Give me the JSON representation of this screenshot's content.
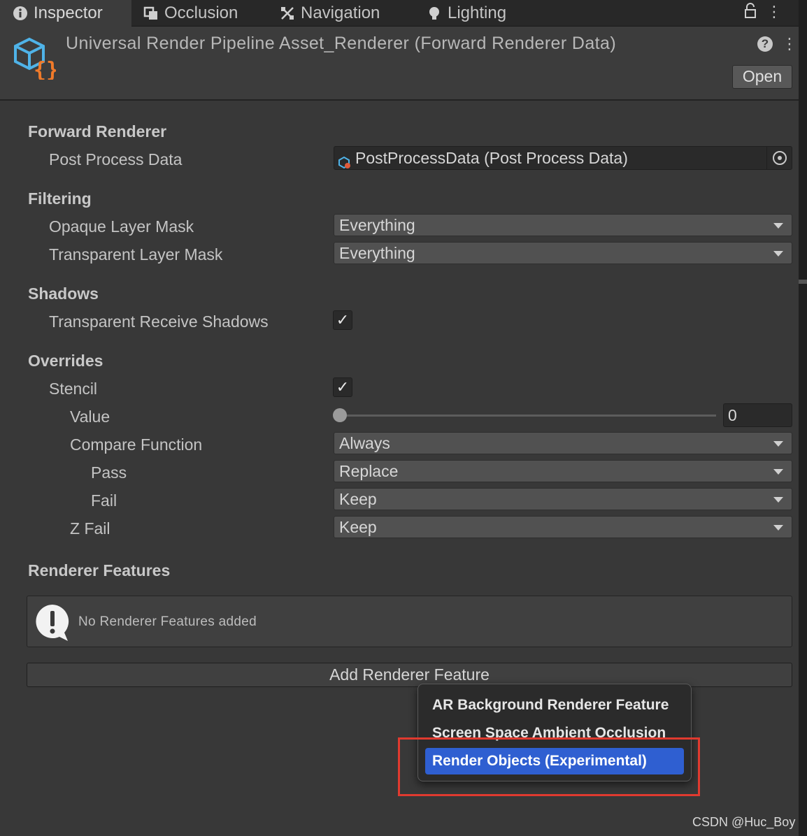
{
  "tabs": [
    {
      "label": "Inspector",
      "icon": "info-icon",
      "active": true
    },
    {
      "label": "Occlusion",
      "icon": "occlusion-icon",
      "active": false
    },
    {
      "label": "Navigation",
      "icon": "navigation-icon",
      "active": false
    },
    {
      "label": "Lighting",
      "icon": "bulb-icon",
      "active": false
    }
  ],
  "header": {
    "title": "Universal Render Pipeline Asset_Renderer (Forward Renderer Data)",
    "open_label": "Open",
    "help_glyph": "?",
    "menu_glyph": "⋮"
  },
  "sections": {
    "forward_renderer": "Forward Renderer",
    "filtering": "Filtering",
    "shadows": "Shadows",
    "overrides": "Overrides",
    "renderer_features": "Renderer Features"
  },
  "fields": {
    "post_process_data": {
      "label": "Post Process Data",
      "value": "PostProcessData (Post Process Data)"
    },
    "opaque_layer_mask": {
      "label": "Opaque Layer Mask",
      "value": "Everything"
    },
    "transparent_layer_mask": {
      "label": "Transparent Layer Mask",
      "value": "Everything"
    },
    "transparent_receive_shadows": {
      "label": "Transparent Receive Shadows",
      "checked": true
    },
    "stencil": {
      "label": "Stencil",
      "checked": true
    },
    "value": {
      "label": "Value",
      "number": "0",
      "slider_fraction": 0
    },
    "compare_function": {
      "label": "Compare Function",
      "value": "Always"
    },
    "pass": {
      "label": "Pass",
      "value": "Replace"
    },
    "fail": {
      "label": "Fail",
      "value": "Keep"
    },
    "z_fail": {
      "label": "Z Fail",
      "value": "Keep"
    }
  },
  "renderer_features": {
    "empty_message": "No Renderer Features added",
    "add_button": "Add Renderer Feature"
  },
  "dropdown": {
    "items": [
      {
        "label": "AR Background Renderer Feature",
        "selected": false
      },
      {
        "label": "Screen Space Ambient Occlusion",
        "selected": false
      },
      {
        "label": "Render Objects (Experimental)",
        "selected": true
      }
    ],
    "selected_color": "#2f5fd1",
    "highlight_color": "#e03a2f"
  },
  "check_glyph": "✓",
  "watermark": "CSDN @Huc_Boy"
}
